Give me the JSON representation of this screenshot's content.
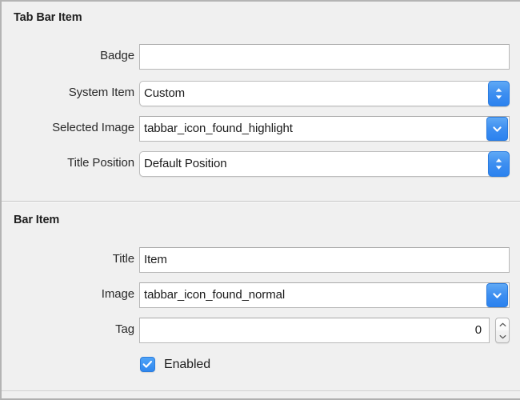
{
  "inspector": {
    "sections": [
      {
        "title": "Tab Bar Item",
        "rows": [
          {
            "label": "Badge",
            "control": "textfield",
            "value": "",
            "placeholder": ""
          },
          {
            "label": "System Item",
            "control": "popup",
            "value": "Custom"
          },
          {
            "label": "Selected Image",
            "control": "combo",
            "value": "tabbar_icon_found_highlight",
            "placeholder": ""
          },
          {
            "label": "Title Position",
            "control": "popup",
            "value": "Default Position"
          }
        ]
      },
      {
        "title": "Bar Item",
        "rows": [
          {
            "label": "Title",
            "control": "textfield",
            "value": "Item",
            "placeholder": ""
          },
          {
            "label": "Image",
            "control": "combo",
            "value": "tabbar_icon_found_normal",
            "placeholder": ""
          },
          {
            "label": "Tag",
            "control": "stepper",
            "value": "0",
            "placeholder": ""
          }
        ],
        "checkbox": {
          "label": "Enabled",
          "checked": true
        }
      }
    ],
    "colors": {
      "accent": "#3d8ef0",
      "panel_background": "#f0f0f0",
      "field_background": "#ffffff",
      "text": "#1f1f1f",
      "border": "#b8b8b8"
    }
  }
}
